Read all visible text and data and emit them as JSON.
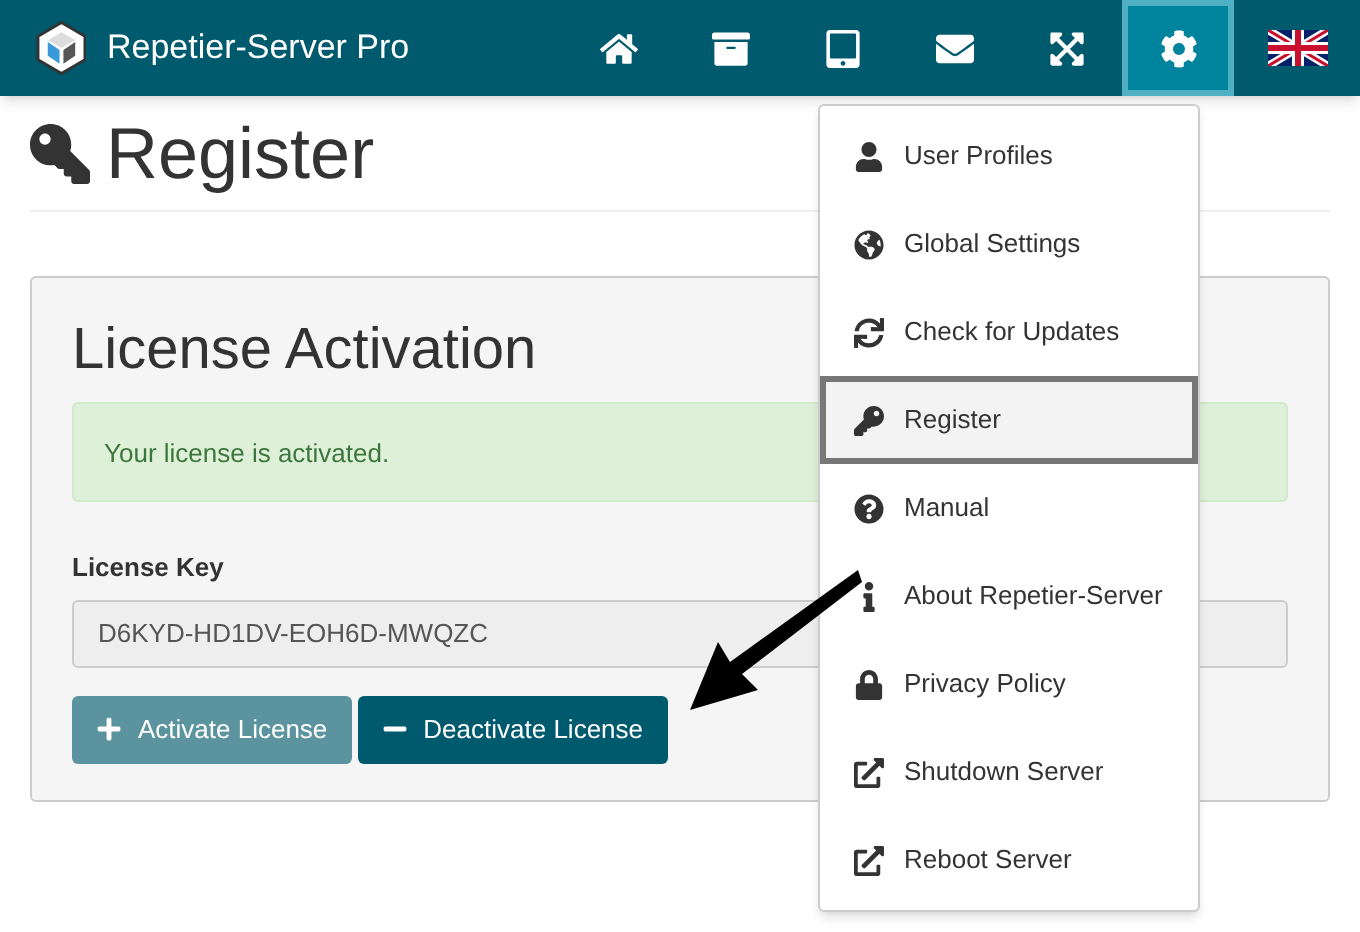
{
  "app": {
    "title": "Repetier-Server Pro"
  },
  "nav_buttons": [
    {
      "selected": false
    },
    {
      "selected": false
    },
    {
      "selected": false
    },
    {
      "selected": false
    },
    {
      "selected": false
    },
    {
      "selected": true
    }
  ],
  "page": {
    "title": "Register"
  },
  "panel": {
    "heading": "License Activation",
    "alert": "Your license is activated.",
    "field_label": "License Key",
    "field_value": "D6KYD-HD1DV-EOH6D-MWQZC",
    "buttons": [
      {
        "label": "Activate License",
        "kind": "add"
      },
      {
        "label": "Deactivate License",
        "kind": "remove"
      }
    ]
  },
  "menu": [
    {
      "label": "User Profiles",
      "selected": false
    },
    {
      "label": "Global Settings",
      "selected": false
    },
    {
      "label": "Check for Updates",
      "selected": false
    },
    {
      "label": "Register",
      "selected": true
    },
    {
      "label": "Manual",
      "selected": false
    },
    {
      "label": "About Repetier-Server",
      "selected": false
    },
    {
      "label": "Privacy Policy",
      "selected": false
    },
    {
      "label": "Shutdown Server",
      "selected": false
    },
    {
      "label": "Reboot Server",
      "selected": false
    }
  ]
}
